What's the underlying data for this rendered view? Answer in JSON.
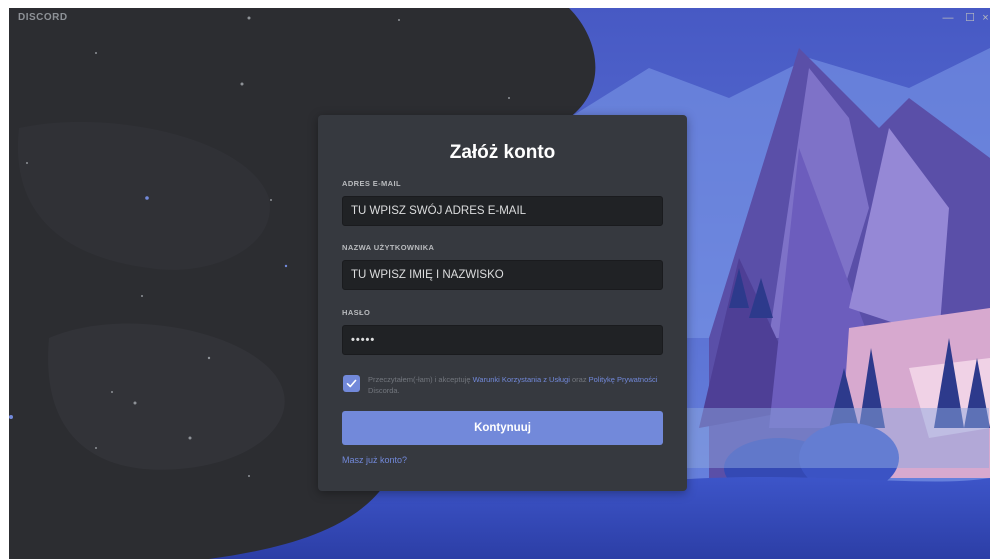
{
  "app": {
    "logo_text": "DISCORD",
    "window_controls": {
      "minimize": "—",
      "maximize": "☐",
      "close": "×"
    }
  },
  "register": {
    "title": "Załóż konto",
    "email": {
      "label": "ADRES E-MAIL",
      "value": "TU WPISZ SWÓJ ADRES E-MAIL"
    },
    "username": {
      "label": "NAZWA UŻYTKOWNIKA",
      "value": "TU WPISZ IMIĘ I NAZWISKO"
    },
    "password": {
      "label": "HASŁO",
      "value": "•••••"
    },
    "terms": {
      "checked": true,
      "prefix": "Przeczytałem(-łam) i akceptuję ",
      "tos_link": "Warunki Korzystania z Usługi",
      "middle": " oraz ",
      "privacy_link": "Politykę Prywatności",
      "suffix": " Discorda."
    },
    "submit_label": "Kontynuuj",
    "login_link": "Masz już konto?"
  },
  "colors": {
    "accent": "#7289da",
    "card": "#36393f",
    "input_bg": "#202225",
    "dark_bg": "#2c2d31"
  },
  "icons": {
    "checkbox": "checkmark-icon"
  }
}
